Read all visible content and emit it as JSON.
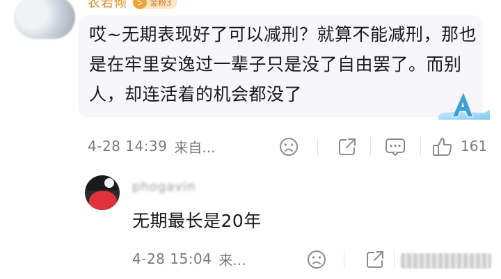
{
  "comment": {
    "username": "农若倾",
    "level_badge": {
      "num": "5",
      "label": "金粉3"
    },
    "text": "哎~无期表现好了可以减刑？就算不能减刑，那也是在牢里安逸过一辈子只是没了自由罢了。而别人，却连活着的机会都没了",
    "time": "4-28 14:39",
    "source": "来自...",
    "likes": "161"
  },
  "reply": {
    "username": "phogavin",
    "text": "无期最长是20年",
    "time": "4-28 15:04",
    "source": "来..."
  },
  "colors": {
    "username": "#e88a1a",
    "bubble_bg": "#f7f6fb",
    "meta_text": "#7a7a7a",
    "icon": "#8c8c8c"
  },
  "icons": [
    "sad-face-icon",
    "share-icon",
    "comment-icon",
    "thumbs-up-icon"
  ]
}
